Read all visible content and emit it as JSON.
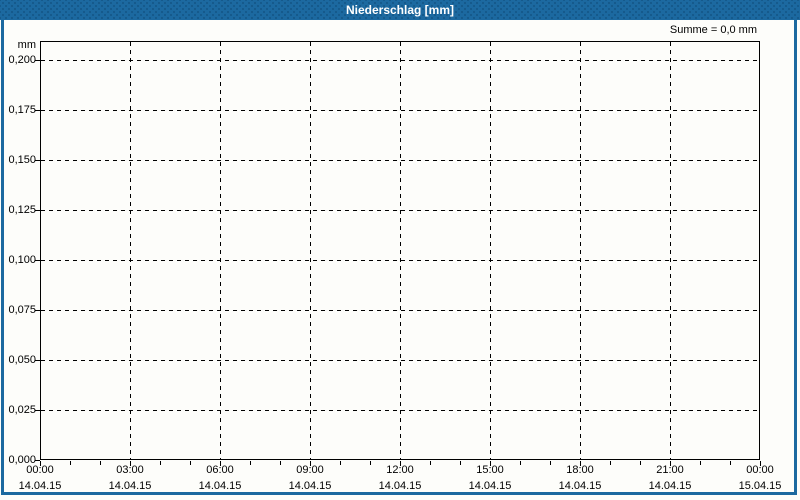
{
  "window": {
    "title": "Niederschlag [mm]"
  },
  "summary": {
    "text": "Summe = 0,0 mm"
  },
  "colors": {
    "titlebar": "#1c69a0",
    "frame": "#1c69a0",
    "grid": "#000000",
    "background": "#fdfdfa",
    "title_text": "#ffffff"
  },
  "chart_data": {
    "type": "bar",
    "title": "Niederschlag [mm]",
    "ylabel": "mm",
    "xlabel": "",
    "ylim": [
      0,
      0.2095
    ],
    "grid": "dashed",
    "legend_position": "none",
    "sum_label": "Summe = 0,0 mm",
    "y_ticks": [
      {
        "value": 0.0,
        "label": "0,000"
      },
      {
        "value": 0.025,
        "label": "0,025"
      },
      {
        "value": 0.05,
        "label": "0,050"
      },
      {
        "value": 0.075,
        "label": "0,075"
      },
      {
        "value": 0.1,
        "label": "0,100"
      },
      {
        "value": 0.125,
        "label": "0,125"
      },
      {
        "value": 0.15,
        "label": "0,150"
      },
      {
        "value": 0.175,
        "label": "0,175"
      },
      {
        "value": 0.2,
        "label": "0,200"
      }
    ],
    "x_ticks": [
      {
        "time": "00:00",
        "date": "14.04.15"
      },
      {
        "time": "03:00",
        "date": "14.04.15"
      },
      {
        "time": "06:00",
        "date": "14.04.15"
      },
      {
        "time": "09:00",
        "date": "14.04.15"
      },
      {
        "time": "12:00",
        "date": "14.04.15"
      },
      {
        "time": "15:00",
        "date": "14.04.15"
      },
      {
        "time": "18:00",
        "date": "14.04.15"
      },
      {
        "time": "21:00",
        "date": "14.04.15"
      },
      {
        "time": "00:00",
        "date": "15.04.15"
      }
    ],
    "x_major_interval_hours": 3,
    "x_minor_interval_hours": 1,
    "series": [
      {
        "name": "Niederschlag",
        "values": []
      }
    ]
  }
}
